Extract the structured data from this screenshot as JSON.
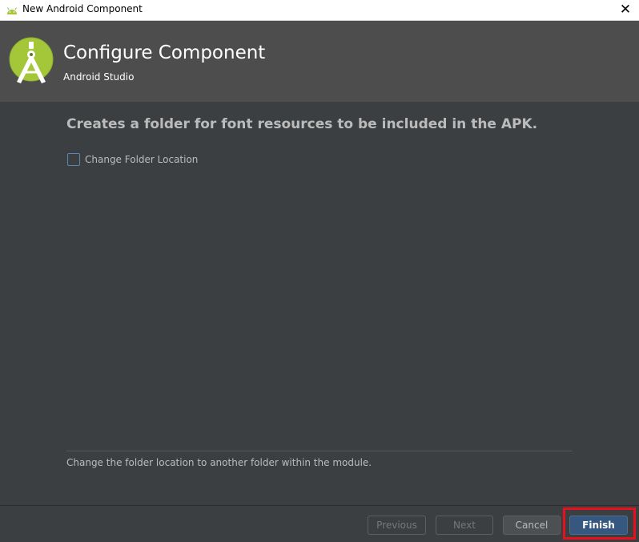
{
  "window": {
    "title": "New Android Component",
    "close_glyph": "✕",
    "icon": "android-icon"
  },
  "banner": {
    "heading": "Configure Component",
    "subheading": "Android Studio",
    "logo": "android-studio-logo"
  },
  "main": {
    "description": "Creates a folder for font resources to be included in the APK.",
    "checkbox": {
      "label": "Change Folder Location",
      "checked": false
    },
    "help_text": "Change the folder location to another folder within the module."
  },
  "footer": {
    "previous_label": "Previous",
    "next_label": "Next",
    "cancel_label": "Cancel",
    "finish_label": "Finish"
  },
  "colors": {
    "background": "#3c3f41",
    "banner": "#4d4d4d",
    "accent": "#365880",
    "highlight": "#e8101b",
    "android_green": "#a4c639"
  }
}
